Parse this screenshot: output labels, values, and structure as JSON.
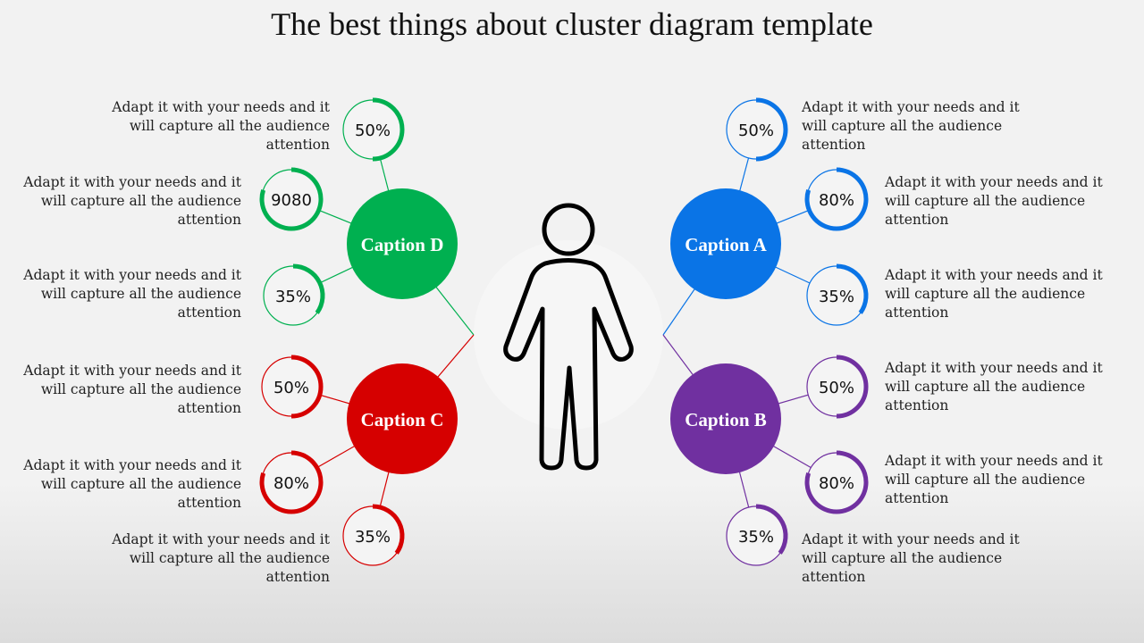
{
  "title": "The best things about cluster diagram template",
  "center_icon": "person-outline-icon",
  "groups": [
    {
      "id": "D",
      "caption": "Caption D",
      "color": "#00b050",
      "side": "left",
      "items": [
        {
          "label": "50%",
          "value": 50,
          "text": "Adapt it with your needs and it will capture all the audience attention"
        },
        {
          "label": "9080",
          "value": 80,
          "text": "Adapt it with your needs and it will capture all the audience attention"
        },
        {
          "label": "35%",
          "value": 35,
          "text": "Adapt it with your needs and it will capture all the audience attention"
        }
      ]
    },
    {
      "id": "C",
      "caption": "Caption C",
      "color": "#d60000",
      "side": "left",
      "items": [
        {
          "label": "50%",
          "value": 50,
          "text": "Adapt it with your needs and it will capture all the audience attention"
        },
        {
          "label": "80%",
          "value": 80,
          "text": "Adapt it with your needs and it will capture all the audience attention"
        },
        {
          "label": "35%",
          "value": 35,
          "text": "Adapt it with your needs and it will capture all the audience attention"
        }
      ]
    },
    {
      "id": "A",
      "caption": "Caption A",
      "color": "#0a74e6",
      "side": "right",
      "items": [
        {
          "label": "50%",
          "value": 50,
          "text": "Adapt it with your needs and it will capture all the audience attention"
        },
        {
          "label": "80%",
          "value": 80,
          "text": "Adapt it with your needs and it will capture all the audience attention"
        },
        {
          "label": "35%",
          "value": 35,
          "text": "Adapt it with your needs and it will capture all the audience attention"
        }
      ]
    },
    {
      "id": "B",
      "caption": "Caption B",
      "color": "#7030a0",
      "side": "right",
      "items": [
        {
          "label": "50%",
          "value": 50,
          "text": "Adapt it with your needs and it will capture all the audience attention"
        },
        {
          "label": "80%",
          "value": 80,
          "text": "Adapt it with your needs and it will capture all the audience attention"
        },
        {
          "label": "35%",
          "value": 35,
          "text": "Adapt it with your needs and it will capture all the audience attention"
        }
      ]
    }
  ]
}
